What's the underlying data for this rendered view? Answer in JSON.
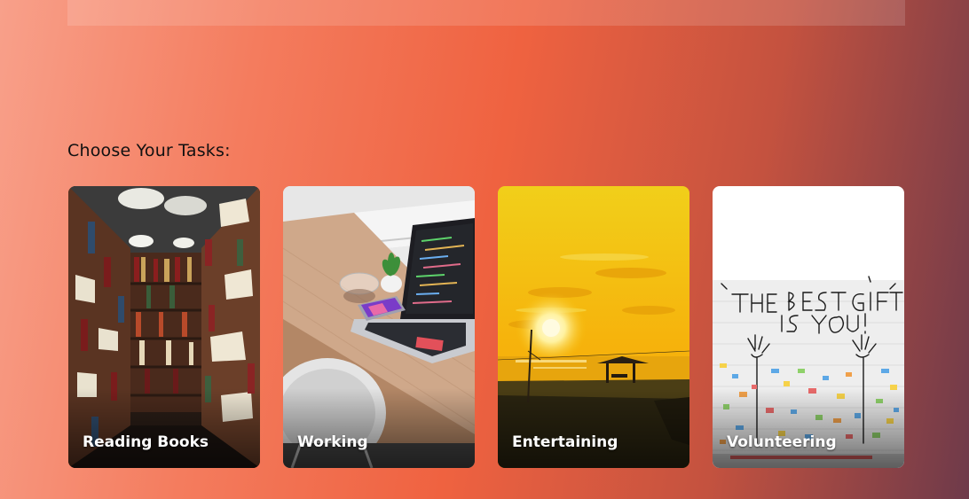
{
  "section": {
    "title": "Choose Your Tasks:"
  },
  "cards": [
    {
      "label": "Reading Books",
      "image": "library-bookshelves-photo"
    },
    {
      "label": "Working",
      "image": "laptop-desk-photo"
    },
    {
      "label": "Entertaining",
      "image": "sunset-beach-photo"
    },
    {
      "label": "Volunteering",
      "image": "best-gift-mural-photo"
    }
  ],
  "mural_text": "THE BEST GIFT IS YOU!"
}
